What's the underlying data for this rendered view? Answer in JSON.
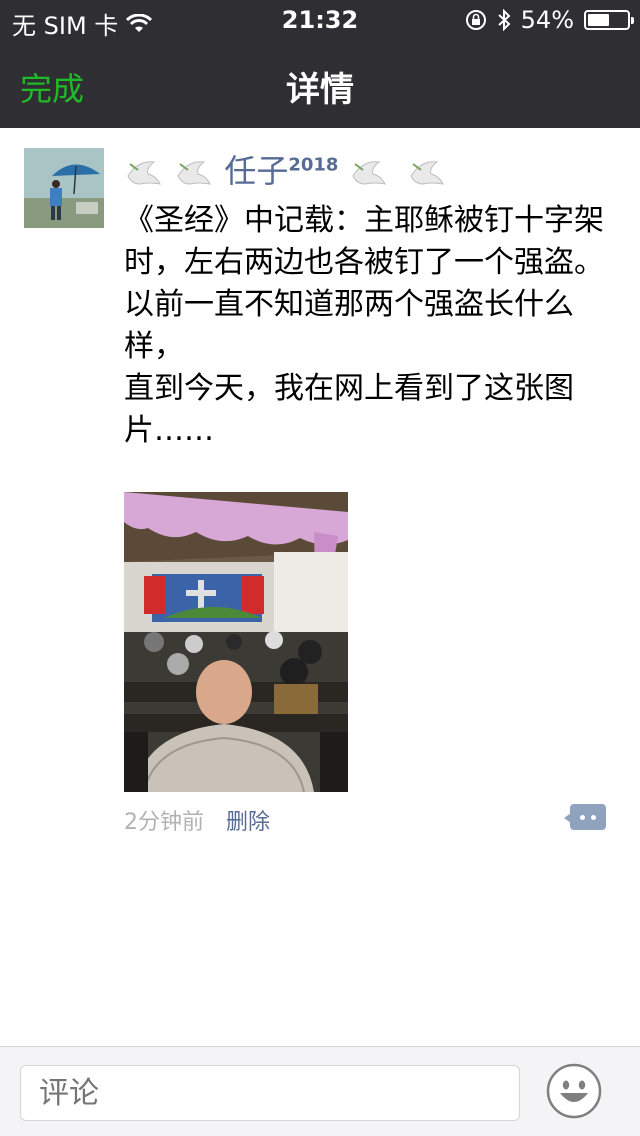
{
  "status_bar": {
    "carrier": "无 SIM 卡",
    "time": "21:32",
    "battery_percent": "54%",
    "battery_level": 0.54,
    "icons": [
      "wifi-icon",
      "rotation-lock-icon",
      "bluetooth-icon",
      "battery-icon"
    ]
  },
  "nav": {
    "done_label": "完成",
    "title": "详情",
    "done_color": "#1fba28"
  },
  "post": {
    "author_name": "任子",
    "author_sup": "2018",
    "decorations": [
      "dove-icon",
      "dove-icon",
      "dove-icon",
      "dove-icon"
    ],
    "text_lines": [
      "《圣经》中记载：主耶稣被钉十字架时，左右两边也各被钉了一个强盗。",
      "以前一直不知道那两个强盗长什么样，",
      "直到今天，我在网上看到了这张图片……"
    ],
    "image": "church-congregation-photo",
    "time_ago": "2分钟前",
    "delete_label": "删除",
    "link_color": "#576b95"
  },
  "bottom": {
    "comment_placeholder": "评论",
    "emoji_icon": "smiley-icon"
  }
}
